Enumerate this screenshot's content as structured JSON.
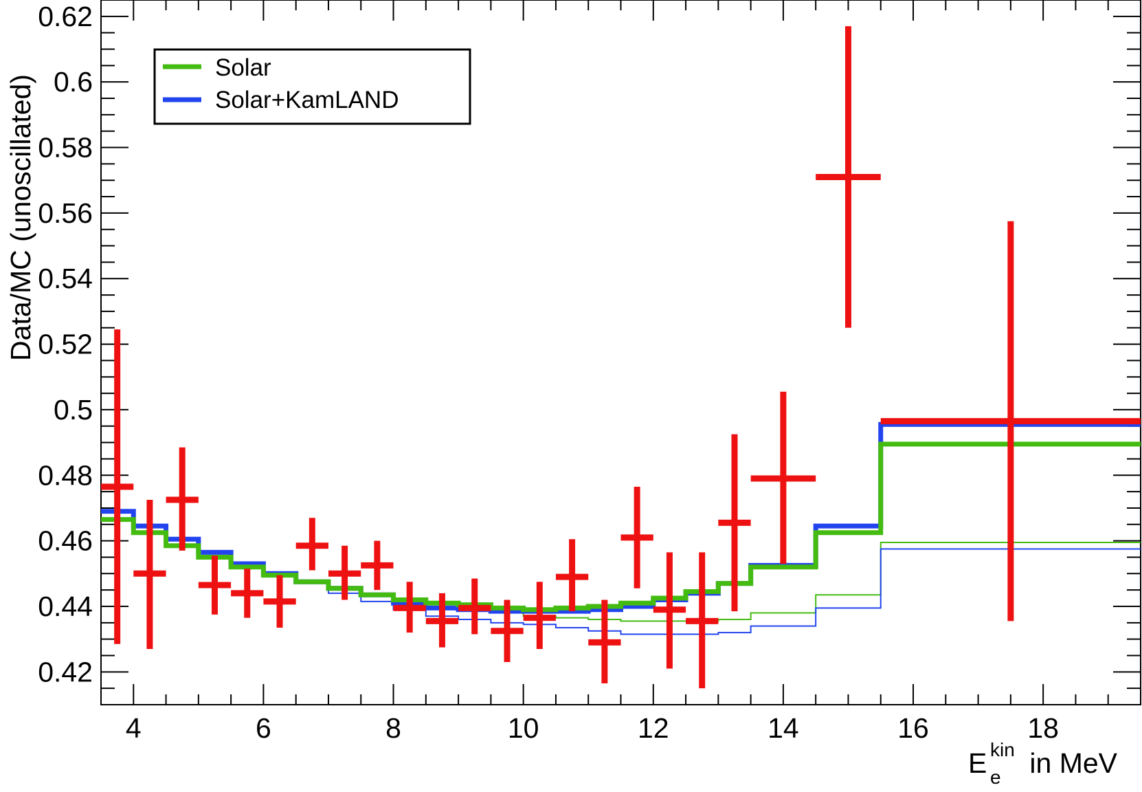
{
  "chart_data": {
    "type": "line",
    "title": "",
    "xlabel": {
      "main": "E",
      "subscript": "e",
      "superscript": "kin",
      "suffix": " in MeV"
    },
    "ylabel": "Data/MC (unoscillated)",
    "xlim": [
      3.5,
      19.5
    ],
    "ylim": [
      0.41,
      0.625
    ],
    "x_ticks": [
      {
        "value": 4,
        "label": "4"
      },
      {
        "value": 6,
        "label": "6"
      },
      {
        "value": 8,
        "label": "8"
      },
      {
        "value": 10,
        "label": "10"
      },
      {
        "value": 12,
        "label": "12"
      },
      {
        "value": 14,
        "label": "14"
      },
      {
        "value": 16,
        "label": "16"
      },
      {
        "value": 18,
        "label": "18"
      }
    ],
    "y_ticks": [
      {
        "value": 0.42,
        "label": "0.42"
      },
      {
        "value": 0.44,
        "label": "0.44"
      },
      {
        "value": 0.46,
        "label": "0.46"
      },
      {
        "value": 0.48,
        "label": "0.48"
      },
      {
        "value": 0.5,
        "label": "0.5"
      },
      {
        "value": 0.52,
        "label": "0.52"
      },
      {
        "value": 0.54,
        "label": "0.54"
      },
      {
        "value": 0.56,
        "label": "0.56"
      },
      {
        "value": 0.58,
        "label": "0.58"
      },
      {
        "value": 0.6,
        "label": "0.6"
      },
      {
        "value": 0.62,
        "label": "0.62"
      }
    ],
    "grid": false,
    "legend": {
      "placement": "top-left",
      "entries": [
        {
          "name": "Solar",
          "color": "#44bb11"
        },
        {
          "name": "Solar+KamLAND",
          "color": "#2244ee"
        }
      ]
    },
    "data_points": {
      "color": "#ee1111",
      "points": [
        {
          "x": 3.75,
          "xerr": 0.25,
          "y": 0.4765,
          "ylo": 0.4285,
          "yhi": 0.5245
        },
        {
          "x": 4.25,
          "xerr": 0.25,
          "y": 0.45,
          "ylo": 0.427,
          "yhi": 0.4725
        },
        {
          "x": 4.75,
          "xerr": 0.25,
          "y": 0.4725,
          "ylo": 0.457,
          "yhi": 0.4885
        },
        {
          "x": 5.25,
          "xerr": 0.25,
          "y": 0.4465,
          "ylo": 0.4375,
          "yhi": 0.4555
        },
        {
          "x": 5.75,
          "xerr": 0.25,
          "y": 0.444,
          "ylo": 0.4365,
          "yhi": 0.4515
        },
        {
          "x": 6.25,
          "xerr": 0.25,
          "y": 0.4415,
          "ylo": 0.4335,
          "yhi": 0.4495
        },
        {
          "x": 6.75,
          "xerr": 0.25,
          "y": 0.4585,
          "ylo": 0.451,
          "yhi": 0.467
        },
        {
          "x": 7.25,
          "xerr": 0.25,
          "y": 0.45,
          "ylo": 0.442,
          "yhi": 0.4585
        },
        {
          "x": 7.75,
          "xerr": 0.25,
          "y": 0.4525,
          "ylo": 0.445,
          "yhi": 0.46
        },
        {
          "x": 8.25,
          "xerr": 0.25,
          "y": 0.4395,
          "ylo": 0.432,
          "yhi": 0.4475
        },
        {
          "x": 8.75,
          "xerr": 0.25,
          "y": 0.4355,
          "ylo": 0.4275,
          "yhi": 0.444
        },
        {
          "x": 9.25,
          "xerr": 0.25,
          "y": 0.4395,
          "ylo": 0.4315,
          "yhi": 0.4485
        },
        {
          "x": 9.75,
          "xerr": 0.25,
          "y": 0.4325,
          "ylo": 0.423,
          "yhi": 0.442
        },
        {
          "x": 10.25,
          "xerr": 0.25,
          "y": 0.4365,
          "ylo": 0.427,
          "yhi": 0.4475
        },
        {
          "x": 10.75,
          "xerr": 0.25,
          "y": 0.449,
          "ylo": 0.4385,
          "yhi": 0.4605
        },
        {
          "x": 11.25,
          "xerr": 0.25,
          "y": 0.429,
          "ylo": 0.4165,
          "yhi": 0.442
        },
        {
          "x": 11.75,
          "xerr": 0.25,
          "y": 0.461,
          "ylo": 0.4455,
          "yhi": 0.4765
        },
        {
          "x": 12.25,
          "xerr": 0.25,
          "y": 0.439,
          "ylo": 0.421,
          "yhi": 0.4565
        },
        {
          "x": 12.75,
          "xerr": 0.25,
          "y": 0.4355,
          "ylo": 0.415,
          "yhi": 0.4565
        },
        {
          "x": 13.25,
          "xerr": 0.25,
          "y": 0.4655,
          "ylo": 0.4385,
          "yhi": 0.4925
        },
        {
          "x": 14.0,
          "xerr": 0.5,
          "y": 0.479,
          "ylo": 0.453,
          "yhi": 0.5055
        },
        {
          "x": 15.0,
          "xerr": 0.5,
          "y": 0.571,
          "ylo": 0.525,
          "yhi": 0.617
        },
        {
          "x": 17.5,
          "xerr": 2.0,
          "y": 0.4965,
          "ylo": 0.4355,
          "yhi": 0.5575
        }
      ]
    },
    "series": [
      {
        "name": "Solar+KamLAND",
        "style": "thick",
        "color": "#2244ee",
        "bin_edges": [
          3.5,
          4,
          4.5,
          5,
          5.5,
          6,
          6.5,
          7,
          7.5,
          8,
          8.5,
          9,
          9.5,
          10,
          10.5,
          11,
          11.5,
          12,
          12.5,
          13,
          13.5,
          14.5,
          15.5,
          19.5
        ],
        "values": [
          0.469,
          0.4645,
          0.4605,
          0.4565,
          0.453,
          0.45,
          0.4475,
          0.4455,
          0.4435,
          0.441,
          0.4395,
          0.439,
          0.4385,
          0.4385,
          0.4385,
          0.439,
          0.44,
          0.442,
          0.444,
          0.447,
          0.4525,
          0.4645,
          0.4955
        ]
      },
      {
        "name": "Solar",
        "style": "thick",
        "color": "#44bb11",
        "bin_edges": [
          3.5,
          4,
          4.5,
          5,
          5.5,
          6,
          6.5,
          7,
          7.5,
          8,
          8.5,
          9,
          9.5,
          10,
          10.5,
          11,
          11.5,
          12,
          12.5,
          13,
          13.5,
          14.5,
          15.5,
          19.5
        ],
        "values": [
          0.4665,
          0.4625,
          0.4585,
          0.455,
          0.452,
          0.4495,
          0.4475,
          0.4455,
          0.4435,
          0.442,
          0.441,
          0.4405,
          0.4395,
          0.439,
          0.4395,
          0.44,
          0.441,
          0.4425,
          0.4445,
          0.447,
          0.452,
          0.4625,
          0.4895
        ]
      },
      {
        "name": "Solar",
        "style": "thin",
        "color": "#44bb11",
        "bin_edges": [
          3.5,
          4,
          4.5,
          5,
          5.5,
          6,
          6.5,
          7,
          7.5,
          8,
          8.5,
          9,
          9.5,
          10,
          10.5,
          11,
          11.5,
          12,
          12.5,
          13,
          13.5,
          14.5,
          15.5,
          19.5
        ],
        "values": [
          0.4665,
          0.4625,
          0.4585,
          0.455,
          0.452,
          0.4495,
          0.4475,
          0.4455,
          0.4435,
          0.4415,
          0.44,
          0.439,
          0.438,
          0.437,
          0.4365,
          0.436,
          0.4355,
          0.4355,
          0.4355,
          0.436,
          0.438,
          0.4435,
          0.4595
        ]
      },
      {
        "name": "Solar+KamLAND",
        "style": "thin",
        "color": "#2244ee",
        "bin_edges": [
          3.5,
          4,
          4.5,
          5,
          5.5,
          6,
          6.5,
          7,
          7.5,
          8,
          8.5,
          9,
          9.5,
          10,
          10.5,
          11,
          11.5,
          12,
          12.5,
          13,
          13.5,
          14.5,
          15.5,
          19.5
        ],
        "values": [
          0.469,
          0.4645,
          0.4605,
          0.4565,
          0.453,
          0.45,
          0.447,
          0.444,
          0.4415,
          0.439,
          0.437,
          0.436,
          0.435,
          0.4345,
          0.4335,
          0.4325,
          0.4315,
          0.4315,
          0.4315,
          0.432,
          0.434,
          0.4395,
          0.4575
        ]
      }
    ]
  }
}
